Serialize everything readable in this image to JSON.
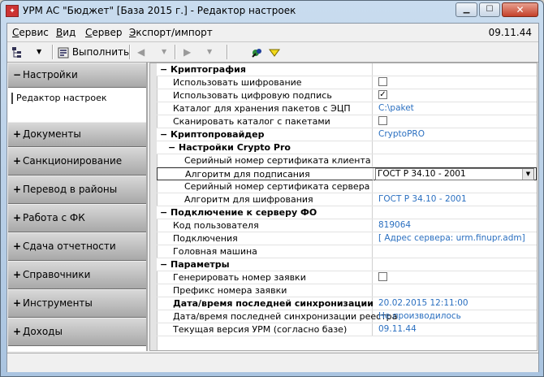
{
  "window": {
    "title": "УРМ АС \"Бюджет\" [База 2015 г.] - Редактор настроек",
    "minimize_glyph": "▁",
    "maximize_glyph": "☐",
    "close_glyph": "✕"
  },
  "menu": {
    "items": [
      "Сервис",
      "Вид",
      "Сервер",
      "Экспорт/импорт"
    ],
    "clock": "09.11.44"
  },
  "toolbar": {
    "execute_label": "Выполнить",
    "tree_icon": "tree-icon",
    "back_glyph": "◀",
    "forward_glyph": "▶",
    "dropdown_glyph": "▼"
  },
  "sidebar": {
    "groups": [
      {
        "sign": "−",
        "label": "Настройки"
      },
      {
        "sign": "+",
        "label": "Документы"
      },
      {
        "sign": "+",
        "label": "Санкционирование"
      },
      {
        "sign": "+",
        "label": "Перевод в районы"
      },
      {
        "sign": "+",
        "label": "Работа с ФК"
      },
      {
        "sign": "+",
        "label": "Сдача отчетности"
      },
      {
        "sign": "+",
        "label": "Справочники"
      },
      {
        "sign": "+",
        "label": "Инструменты"
      },
      {
        "sign": "+",
        "label": "Доходы"
      }
    ],
    "sub_item": "Редактор настроек"
  },
  "grid": {
    "rows": [
      {
        "type": "category",
        "name": "− Криптография"
      },
      {
        "name": "Использовать шифрование",
        "check": ""
      },
      {
        "name": "Использовать цифровую подпись",
        "check": "✓"
      },
      {
        "name": "Каталог для хранения пакетов с ЭЦП",
        "value": "C:\\paket"
      },
      {
        "name": "Сканировать каталог с пакетами",
        "check": ""
      },
      {
        "type": "category",
        "name": "− Криптопровайдер",
        "value": "CryptoPRO"
      },
      {
        "type": "category",
        "name": "− Настройки Crypto Pro"
      },
      {
        "name": "Серийный номер сертификата клиента"
      },
      {
        "name": "Алгоритм для подписания",
        "combo": "ГОСТ Р 34.10 - 2001"
      },
      {
        "name": "Серийный номер сертификата сервера"
      },
      {
        "name": "Алгоритм для шифрования",
        "value": "ГОСТ Р 34.10 - 2001"
      },
      {
        "type": "category",
        "name": "− Подключение к серверу ФО"
      },
      {
        "name": "Код пользователя",
        "value": "819064"
      },
      {
        "name": "Подключения",
        "value": "[ Адрес сервера: urm.finupr.adm]"
      },
      {
        "name": "Головная машина"
      },
      {
        "type": "category",
        "name": "− Параметры"
      },
      {
        "name": "Генерировать номер заявки",
        "check": ""
      },
      {
        "name": "Префикс номера заявки"
      },
      {
        "name": "Дата/время последней синхронизации",
        "value": "20.02.2015 12:11:00",
        "bold": true
      },
      {
        "name": "Дата/время последней синхронизации реестра",
        "value": "Не производилось"
      },
      {
        "name": "Текущая версия УРМ (согласно базе)",
        "value": "09.11.44"
      }
    ]
  }
}
